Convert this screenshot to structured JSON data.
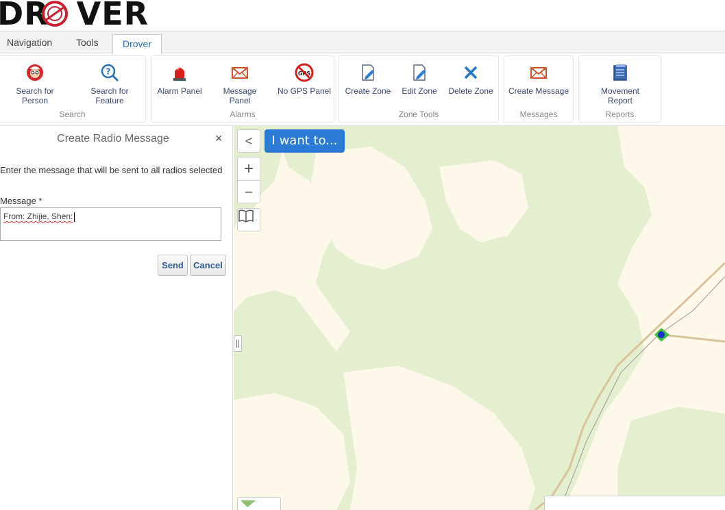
{
  "app": {
    "logo_text": "DROVER"
  },
  "tabs": [
    {
      "label": "Navigation"
    },
    {
      "label": "Tools"
    },
    {
      "label": "Drover",
      "active": true
    }
  ],
  "ribbon": {
    "groups": [
      {
        "label": "Search",
        "buttons": [
          {
            "label": "Search for Person",
            "icon": "wally-icon"
          },
          {
            "label": "Search for Feature",
            "icon": "magnifier-question-icon"
          }
        ]
      },
      {
        "label": "Alarms",
        "buttons": [
          {
            "label": "Alarm Panel",
            "icon": "siren-icon"
          },
          {
            "label": "Message Panel",
            "icon": "envelope-icon"
          },
          {
            "label": "No GPS Panel",
            "icon": "no-gps-icon"
          }
        ]
      },
      {
        "label": "Zone Tools",
        "buttons": [
          {
            "label": "Create Zone",
            "icon": "doc-pen-icon"
          },
          {
            "label": "Edit Zone",
            "icon": "doc-pen-icon"
          },
          {
            "label": "Delete Zone",
            "icon": "x-icon"
          }
        ]
      },
      {
        "label": "Messages",
        "buttons": [
          {
            "label": "Create Message",
            "icon": "envelope-icon"
          }
        ]
      },
      {
        "label": "Reports",
        "buttons": [
          {
            "label": "Movement Report",
            "icon": "report-icon"
          }
        ]
      }
    ]
  },
  "panel": {
    "title": "Create Radio Message",
    "close_symbol": "×",
    "description": "Enter the message that will be sent to all radios selected",
    "message_label": "Message *",
    "message_value": "From: Zhijie, Shen:",
    "send_label": "Send",
    "cancel_label": "Cancel"
  },
  "map": {
    "i_want_to_label": "I want to...",
    "collapse_symbol": "<",
    "zoom_in_symbol": "+",
    "zoom_out_symbol": "−",
    "colors": {
      "land": "#fdf8ea",
      "forest": "#e3efcf",
      "road": "#d9c39a",
      "marker": "#1a33cc",
      "marker_arrow": "#3fbf3f"
    }
  },
  "colors": {
    "accent": "#2b7bd6",
    "tab_active": "#2b6cb0",
    "logo_red": "#c8202a"
  }
}
